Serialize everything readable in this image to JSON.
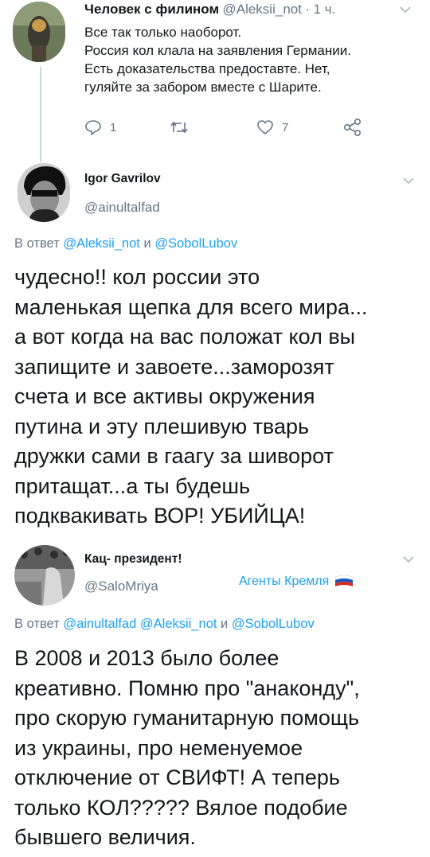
{
  "tweet1": {
    "name": "Человек с филином",
    "handle": "@Aleksii_not",
    "separator": "·",
    "time": "1 ч.",
    "lines": [
      "Все так только наоборот.",
      "Россия кол клала на заявления Германии.",
      "Есть доказательства предоставте. Нет,",
      "гуляйте за забором вместе с Шарите."
    ],
    "reply_count": "1",
    "retweet_count": "",
    "like_count": "7"
  },
  "tweet2": {
    "name": "Igor Gavrilov",
    "handle": "@ainultalfad",
    "reply_prefix": "В ответ",
    "reply_handle1": "@Aleksii_not",
    "reply_and": "и",
    "reply_handle2": "@SobolLubov",
    "lines": [
      "чудесно!! кол россии это",
      "маленькая щепка для всего мира...",
      "а вот когда на вас положат кол вы",
      "запищите и  завоете...заморозят",
      "счета и все активы окружения",
      "путина и эту плешивую тварь",
      "дружки сами в гаагу за шиворот",
      "притащат...а ты будешь",
      "подквакивать ВОР! УБИЙЦА!"
    ]
  },
  "tweet3": {
    "name": "Кац- президент!",
    "handle": "@SaloMriya",
    "badge": "Агенты Кремля",
    "reply_prefix": "В ответ",
    "reply_handle1": "@ainultalfad",
    "reply_handle2": "@Aleksii_not",
    "reply_and": "и",
    "reply_handle3": "@SobolLubov",
    "lines": [
      "В 2008 и 2013 было более",
      "креативно. Помню про \"анаконду\",",
      "про скорую гуманитарную помощь",
      "из украины, про неменуемое",
      "отключение от СВИФТ! А теперь",
      "только КОЛ????? Вялое подобие",
      "бывшего величия."
    ]
  },
  "colors": {
    "text": "#14171a",
    "secondary": "#657786",
    "link": "#1da1f2",
    "line": "#ccd6dd"
  },
  "icons": [
    "reply-icon",
    "retweet-icon",
    "like-icon",
    "share-icon",
    "chevron-down-icon",
    "russian-flag-icon"
  ]
}
